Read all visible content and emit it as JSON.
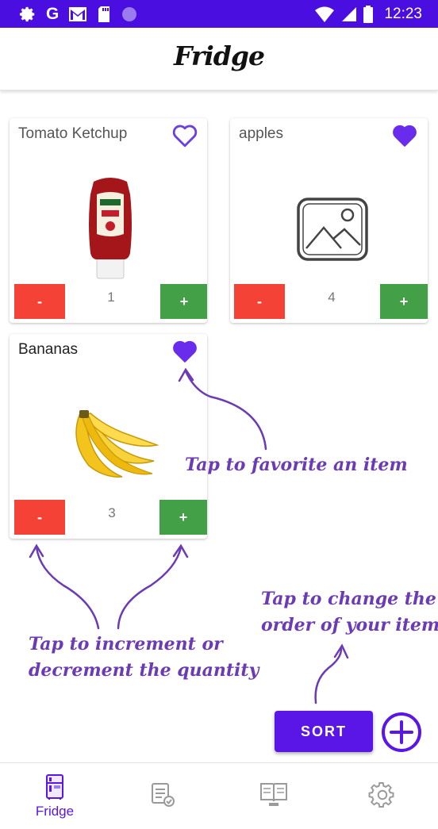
{
  "status_bar": {
    "time": "12:23",
    "left_icons": [
      "gear-icon",
      "google-g-icon",
      "gmail-icon",
      "sd-card-icon",
      "circle-icon"
    ],
    "right_icons": [
      "wifi-icon",
      "signal-icon",
      "battery-icon"
    ],
    "g_label": "G"
  },
  "app_bar": {
    "title": "Fridge"
  },
  "items": [
    {
      "name": "Tomato Ketchup",
      "quantity": "1",
      "favorite": false,
      "image": "ketchup-bottle",
      "minus_label": "-",
      "plus_label": "+"
    },
    {
      "name": "apples",
      "quantity": "4",
      "favorite": true,
      "image": "image-placeholder-icon",
      "minus_label": "-",
      "plus_label": "+"
    },
    {
      "name": "Bananas",
      "quantity": "3",
      "favorite": true,
      "image": "bananas",
      "minus_label": "-",
      "plus_label": "+"
    }
  ],
  "annotations": {
    "favorite": "Tap to favorite an item",
    "sort_line1": "Tap to change the",
    "sort_line2": "order of your items",
    "quantity_line1": "Tap to increment or",
    "quantity_line2": "decrement the quantity"
  },
  "actions": {
    "sort_label": "SORT",
    "add_icon": "add-circle-icon"
  },
  "bottom_nav": {
    "items": [
      {
        "label": "Fridge",
        "icon": "fridge-icon",
        "active": true
      },
      {
        "label": "",
        "icon": "list-check-icon",
        "active": false
      },
      {
        "label": "",
        "icon": "recipe-book-icon",
        "active": false
      },
      {
        "label": "",
        "icon": "settings-gear-icon",
        "active": false
      }
    ]
  },
  "colors": {
    "primary": "#5a16e6",
    "status_bar": "#4a0fe0",
    "minus": "#f44336",
    "plus": "#43a047",
    "annotation": "#6a3bb5"
  }
}
